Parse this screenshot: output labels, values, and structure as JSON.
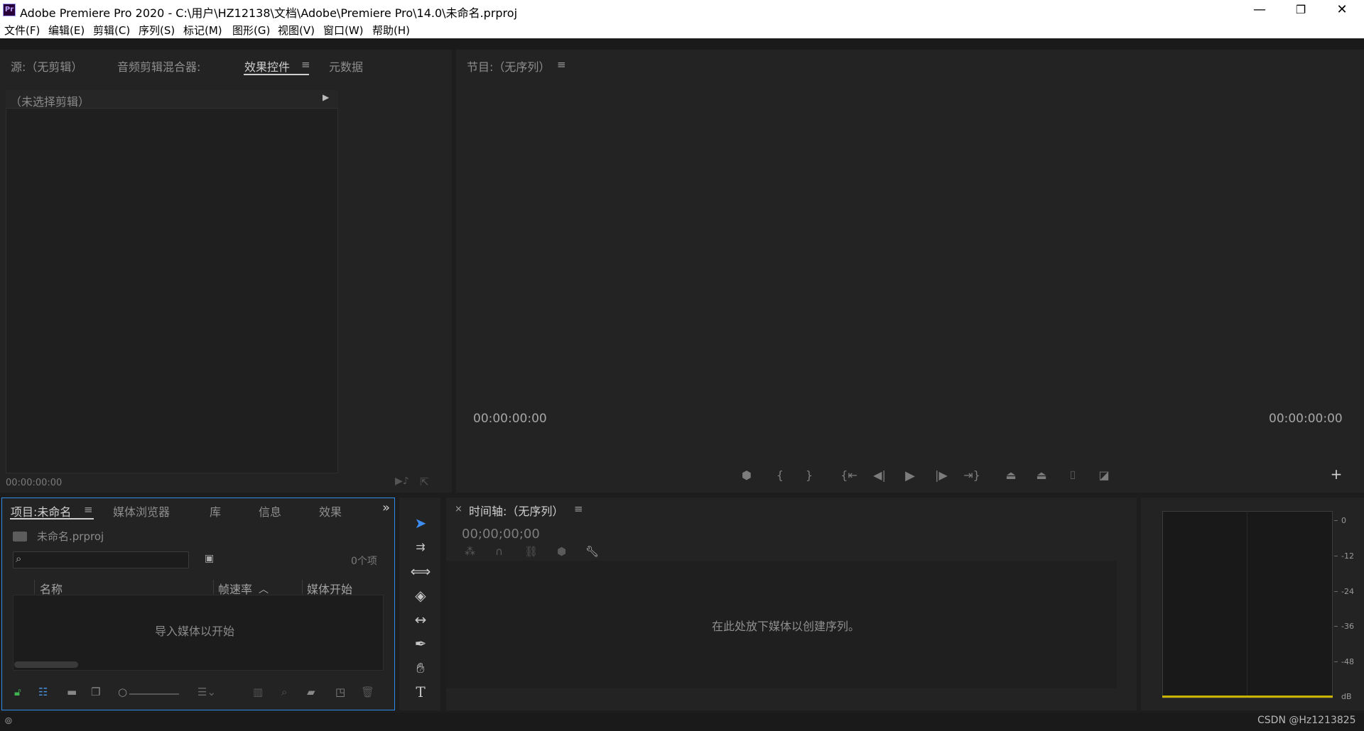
{
  "window": {
    "logo": "Pr",
    "title": "Adobe Premiere Pro 2020 - C:\\用户\\HZ12138\\文档\\Adobe\\Premiere Pro\\14.0\\未命名.prproj",
    "minimize": "—",
    "restore": "❐",
    "close": "✕"
  },
  "menu": [
    "文件(F)",
    "编辑(E)",
    "剪辑(C)",
    "序列(S)",
    "标记(M)",
    "图形(G)",
    "视图(V)",
    "窗口(W)",
    "帮助(H)"
  ],
  "source_panel": {
    "tabs": [
      "源:（无剪辑）",
      "音频剪辑混合器:",
      "效果控件",
      "元数据"
    ],
    "active_tab": "效果控件",
    "no_clip_text": "（未选择剪辑）",
    "timecode": "00:00:00:00"
  },
  "program_panel": {
    "title": "节目:（无序列）",
    "time_left": "00:00:00:00",
    "time_right": "00:00:00:00"
  },
  "project_panel": {
    "tabs": [
      "项目:未命名",
      "媒体浏览器",
      "库",
      "信息",
      "效果"
    ],
    "active_tab": "项目:未命名",
    "overflow": "»",
    "project_file": "未命名.prproj",
    "item_count": "0个项",
    "columns": [
      "名称",
      "帧速率",
      "媒体开始"
    ],
    "empty_text": "导入媒体以开始"
  },
  "timeline_panel": {
    "close": "×",
    "title": "时间轴:（无序列）",
    "timecode": "00;00;00;00",
    "drop_text": "在此处放下媒体以创建序列。"
  },
  "audio_meter": {
    "db_labels": [
      "0",
      "-12",
      "-24",
      "-36",
      "-48",
      "dB"
    ],
    "level_color": "#c8b400"
  },
  "status": {
    "watermark": "CSDN @Hz1213825"
  }
}
